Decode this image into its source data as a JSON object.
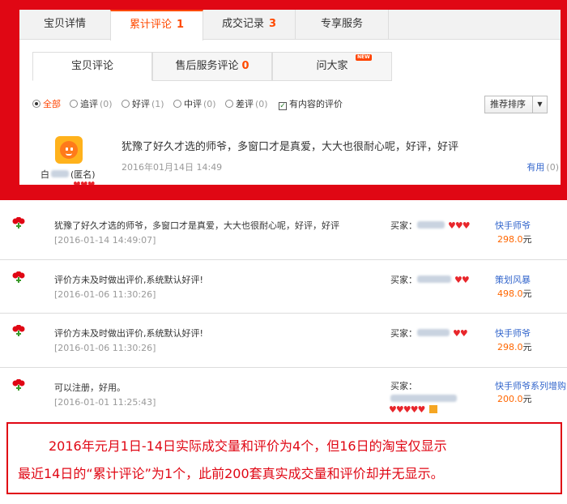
{
  "main_tabs": [
    {
      "label": "宝贝详情",
      "count": ""
    },
    {
      "label": "累计评论",
      "count": "1"
    },
    {
      "label": "成交记录",
      "count": "3"
    },
    {
      "label": "专享服务",
      "count": ""
    }
  ],
  "sub_tabs": [
    {
      "label": "宝贝评论",
      "count": ""
    },
    {
      "label": "售后服务评论",
      "count": "0"
    },
    {
      "label": "问大家",
      "count": "",
      "badge": "NEW"
    }
  ],
  "filters": [
    {
      "label": "全部",
      "count": "",
      "type": "radio",
      "selected": true
    },
    {
      "label": "追评",
      "count": "(0)",
      "type": "radio",
      "selected": false
    },
    {
      "label": "好评",
      "count": "(1)",
      "type": "radio",
      "selected": false
    },
    {
      "label": "中评",
      "count": "(0)",
      "type": "radio",
      "selected": false
    },
    {
      "label": "差评",
      "count": "(0)",
      "type": "radio",
      "selected": false
    },
    {
      "label": "有内容的评价",
      "count": "",
      "type": "checkbox",
      "selected": true
    }
  ],
  "sort": {
    "label": "推荐排序"
  },
  "review": {
    "reviewer_visible": "白",
    "reviewer_suffix": "(匿名)",
    "text": "犹豫了好久才选的师爷，多窗口才是真爱，大大也很耐心呢，好评，好评",
    "date": "2016年01月14日 14:49",
    "useful_label": "有用",
    "useful_count": "(0)"
  },
  "records": [
    {
      "text": "犹豫了好久才选的师爷，多窗口才是真爱，大大也很耐心呢，好评，好评",
      "date": "[2016-01-14 14:49:07]",
      "buyer_label": "买家：",
      "item": "快手师爷",
      "price": "298.0",
      "unit": "元"
    },
    {
      "text": "评价方未及时做出评价,系统默认好评!",
      "date": "[2016-01-06 11:30:26]",
      "buyer_label": "买家：",
      "item": "策划风暴",
      "price": "498.0",
      "unit": "元"
    },
    {
      "text": "评价方未及时做出评价,系统默认好评!",
      "date": "[2016-01-06 11:30:26]",
      "buyer_label": "买家：",
      "item": "快手师爷",
      "price": "298.0",
      "unit": "元"
    },
    {
      "text": "可以注册，好用。",
      "date": "[2016-01-01 11:25:43]",
      "buyer_label": "买家：",
      "item": "快手师爷系列增购",
      "price": "200.0",
      "unit": "元"
    }
  ],
  "note": {
    "line1": "2016年元月1日-14日实际成交量和评价为4个，但16日的淘宝仅显示",
    "line2": "最近14日的“累计评论”为1个，此前200套真实成交量和评价却并无显示。"
  },
  "colors": {
    "frame_red": "#e00714",
    "accent_orange": "#ff4a00",
    "link_blue": "#3366cc"
  }
}
